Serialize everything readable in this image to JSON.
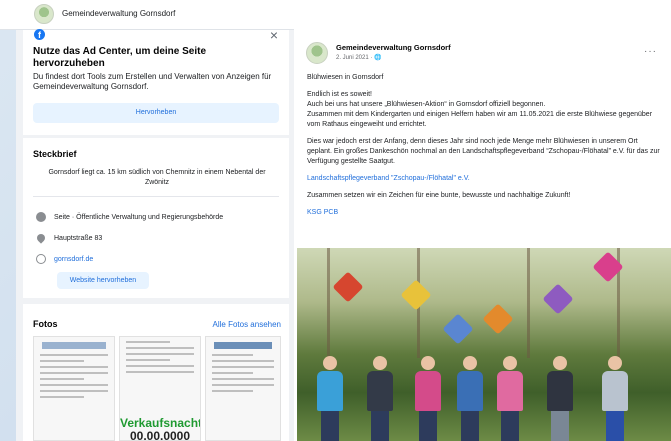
{
  "page": {
    "title": "Gemeindeverwaltung Gornsdorf"
  },
  "ad_center": {
    "title": "Nutze das Ad Center, um deine Seite hervorzuheben",
    "description": "Du findest dort Tools zum Erstellen und Verwalten von Anzeigen für Gemeindeverwaltung Gornsdorf.",
    "button": "Hervorheben"
  },
  "steckbrief": {
    "heading": "Steckbrief",
    "description": "Gornsdorf liegt ca. 15 km südlich von Chemnitz in einem Nebental der Zwönitz",
    "category": "Seite · Öffentliche Verwaltung und Regierungsbehörde",
    "address": "Hauptstraße 83",
    "website": "gornsdorf.de",
    "website_button": "Website hervorheben"
  },
  "fotos": {
    "heading": "Fotos",
    "all_link": "Alle Fotos ansehen",
    "thumb_sale_text": "Verkaufsnacht",
    "thumb_date_text": "00.00.0000"
  },
  "post": {
    "author": "Gemeindeverwaltung Gornsdorf",
    "date": "2. Juni 2021 · 🌐",
    "more": "···",
    "subject": "Blühwiesen in Gornsdorf",
    "para1": "Endlich ist es soweit!",
    "para2": "Auch bei uns hat unsere „Blühwiesen-Aktion“ in Gornsdorf offiziell begonnen.",
    "para3": "Zusammen mit dem Kindergarten und einigen Helfern haben wir am 11.05.2021 die erste Blühwiese gegenüber vom Rathaus eingeweiht und errichtet.",
    "para4": "Dies war jedoch erst der Anfang, denn dieses Jahr sind noch jede Menge mehr Blühwiesen in unserem Ort geplant. Ein großes Dankeschön nochmal an den Landschaftspflegeverband “Zschopau-/Flöhatal” e.V. für das zur Verfügung gestellte Saatgut.",
    "link_text": "Landschaftspflegeverband \"Zschopau-/Flöhatal\" e.V.",
    "closing": "Zusammen setzen wir ein Zeichen für eine bunte, bewusste und nachhaltige Zukunft!",
    "tag": "KSG PCB"
  },
  "icons": {
    "facebook": "facebook-icon",
    "close": "close-icon",
    "info": "info-icon",
    "pin": "location-pin-icon",
    "globe": "globe-icon"
  },
  "colors": {
    "accent": "#216fdb",
    "button_bg": "#e7f3ff",
    "sale_green": "#1f9a31"
  }
}
